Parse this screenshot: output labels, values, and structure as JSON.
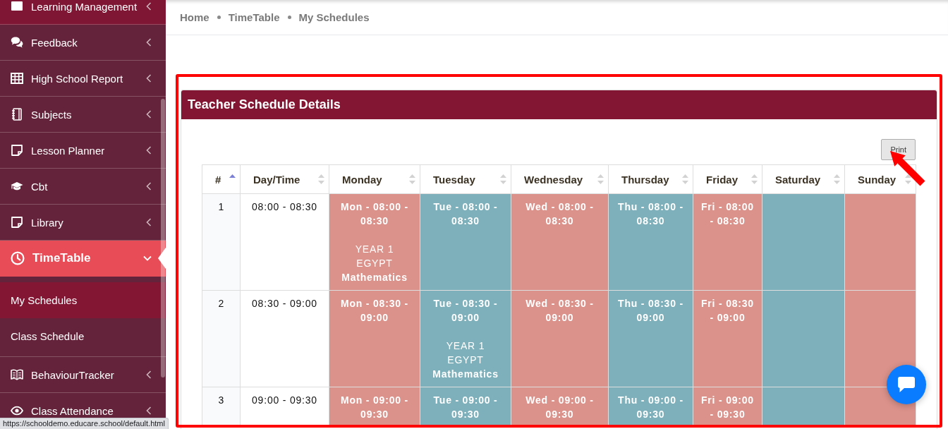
{
  "sidebar": {
    "items": [
      {
        "label": "Learning Management",
        "hovered": true,
        "selected": false,
        "expanded": false
      },
      {
        "label": "Feedback",
        "hovered": false,
        "selected": false,
        "expanded": false
      },
      {
        "label": "High School Report",
        "hovered": false,
        "selected": false,
        "expanded": false
      },
      {
        "label": "Subjects",
        "hovered": false,
        "selected": false,
        "expanded": false
      },
      {
        "label": "Lesson Planner",
        "hovered": false,
        "selected": false,
        "expanded": false
      },
      {
        "label": "Cbt",
        "hovered": false,
        "selected": false,
        "expanded": false
      },
      {
        "label": "Library",
        "hovered": false,
        "selected": false,
        "expanded": false
      },
      {
        "label": "TimeTable",
        "hovered": false,
        "selected": true,
        "expanded": true,
        "children": [
          {
            "label": "My Schedules",
            "selected": true
          },
          {
            "label": "Class Schedule",
            "selected": false
          }
        ]
      },
      {
        "label": "BehaviourTracker",
        "hovered": false,
        "selected": false,
        "expanded": false
      },
      {
        "label": "Class Attendance",
        "hovered": false,
        "selected": false,
        "expanded": false
      }
    ]
  },
  "breadcrumb": [
    {
      "label": "Home"
    },
    {
      "label": "TimeTable"
    },
    {
      "label": "My Schedules"
    }
  ],
  "card": {
    "title": "Teacher Schedule Details",
    "print_button": "Print"
  },
  "table": {
    "columns": [
      {
        "label": "#",
        "sorted": true
      },
      {
        "label": "Day/Time",
        "sorted": false
      },
      {
        "label": "Monday",
        "sorted": false
      },
      {
        "label": "Tuesday",
        "sorted": false
      },
      {
        "label": "Wednesday",
        "sorted": false
      },
      {
        "label": "Thursday",
        "sorted": false
      },
      {
        "label": "Friday",
        "sorted": false
      },
      {
        "label": "Saturday",
        "sorted": false
      },
      {
        "label": "Sunday",
        "sorted": false
      }
    ],
    "rows": [
      {
        "cells": [
          {
            "kind": "number",
            "text": "1"
          },
          {
            "kind": "time",
            "text": "08:00 - 08:30"
          },
          {
            "kind": "slot",
            "title": "Mon - 08:00 - 08:30",
            "lines": [
              "YEAR 1",
              "EGYPT"
            ],
            "subject": "Mathematics",
            "color": "#db928b"
          },
          {
            "kind": "slot",
            "title": "Tue - 08:00 - 08:30",
            "color": "#7db0ba"
          },
          {
            "kind": "slot",
            "title": "Wed - 08:00 - 08:30",
            "color": "#db928b"
          },
          {
            "kind": "slot",
            "title": "Thu - 08:00 - 08:30",
            "color": "#7db0ba"
          },
          {
            "kind": "slot",
            "title": "Fri - 08:00 - 08:30",
            "color": "#db928b"
          },
          {
            "kind": "slot",
            "color": "#7db0ba"
          },
          {
            "kind": "slot",
            "color": "#db928b"
          }
        ]
      },
      {
        "cells": [
          {
            "kind": "number",
            "text": "2"
          },
          {
            "kind": "time",
            "text": "08:30 - 09:00"
          },
          {
            "kind": "slot",
            "title": "Mon - 08:30 - 09:00",
            "color": "#db928b"
          },
          {
            "kind": "slot",
            "title": "Tue - 08:30 - 09:00",
            "lines": [
              "YEAR 1",
              "EGYPT"
            ],
            "subject": "Mathematics",
            "color": "#7db0ba"
          },
          {
            "kind": "slot",
            "title": "Wed - 08:30 - 09:00",
            "color": "#db928b"
          },
          {
            "kind": "slot",
            "title": "Thu - 08:30 - 09:00",
            "color": "#7db0ba"
          },
          {
            "kind": "slot",
            "title": "Fri - 08:30 - 09:00",
            "color": "#db928b"
          },
          {
            "kind": "slot",
            "color": "#7db0ba"
          },
          {
            "kind": "slot",
            "color": "#db928b"
          }
        ]
      },
      {
        "cells": [
          {
            "kind": "number",
            "text": "3"
          },
          {
            "kind": "time",
            "text": "09:00 - 09:30"
          },
          {
            "kind": "slot",
            "title": "Mon - 09:00 - 09:30",
            "color": "#db928b"
          },
          {
            "kind": "slot",
            "title": "Tue - 09:00 - 09:30",
            "color": "#7db0ba"
          },
          {
            "kind": "slot",
            "title": "Wed - 09:00 - 09:30",
            "color": "#db928b"
          },
          {
            "kind": "slot",
            "title": "Thu - 09:00 - 09:30",
            "color": "#7db0ba"
          },
          {
            "kind": "slot",
            "title": "Fri - 09:00 - 09:30",
            "color": "#db928b"
          },
          {
            "kind": "slot",
            "color": "#7db0ba"
          },
          {
            "kind": "slot",
            "color": "#db928b"
          }
        ]
      }
    ]
  },
  "annotations": {
    "frame": true,
    "arrow": true
  },
  "browser_status": {
    "url": "https://schooldemo.educare.school/default.html"
  }
}
